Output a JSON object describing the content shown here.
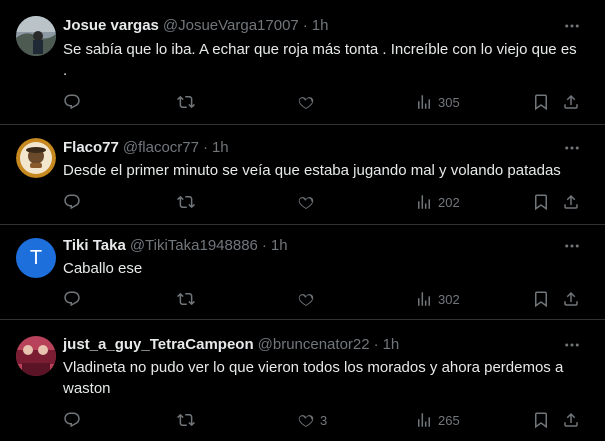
{
  "tweets": [
    {
      "name": "Josue vargas",
      "handle": "@JosueVarga17007",
      "sep": "·",
      "time": "1h",
      "text": "Se sabía que lo iba. A echar que roja más tonta . Increíble con lo viejo que es .",
      "likes": "",
      "views": "305"
    },
    {
      "name": "Flaco77",
      "handle": "@flacocr77",
      "sep": "·",
      "time": "1h",
      "text": "Desde el primer minuto se veía que estaba jugando mal y volando patadas",
      "likes": "",
      "views": "202"
    },
    {
      "name": "Tiki Taka",
      "handle": "@TikiTaka1948886",
      "sep": "·",
      "time": "1h",
      "avatar_letter": "T",
      "text": "Caballo ese",
      "likes": "",
      "views": "302"
    },
    {
      "name": "just_a_guy_TetraCampeon",
      "handle": "@bruncenator22",
      "sep": "·",
      "time": "1h",
      "text": "Vladineta no pudo ver lo que vieron todos los morados y ahora perdemos a waston",
      "likes": "3",
      "views": "265"
    }
  ],
  "colors": {
    "background": "#000000",
    "text_primary": "#e7e9ea",
    "text_secondary": "#71767b",
    "divider": "#2f3336",
    "tiki_avatar": "#1d6fdc"
  },
  "icons": [
    "reply-icon",
    "retweet-icon",
    "like-icon",
    "views-icon",
    "bookmark-icon",
    "share-icon",
    "more-icon"
  ]
}
